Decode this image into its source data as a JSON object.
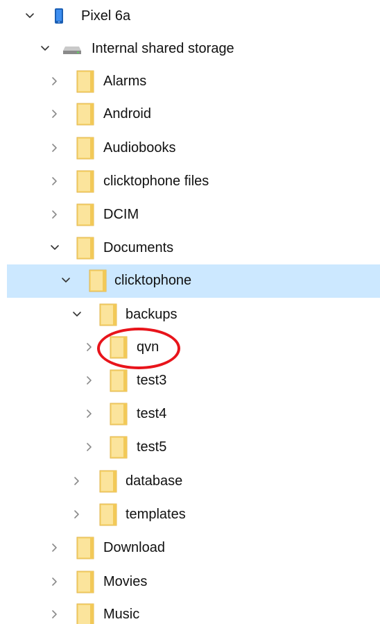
{
  "tree": [
    {
      "id": "device",
      "name": "Pixel 6a",
      "icon": "phone-icon",
      "state": "expanded",
      "level": 0
    },
    {
      "id": "storage",
      "name": "Internal shared storage",
      "icon": "drive-icon",
      "state": "expanded",
      "level": 1
    },
    {
      "id": "alarms",
      "name": "Alarms",
      "icon": "folder-icon",
      "state": "collapsed",
      "level": 2
    },
    {
      "id": "android",
      "name": "Android",
      "icon": "folder-icon",
      "state": "collapsed",
      "level": 2
    },
    {
      "id": "audiobooks",
      "name": "Audiobooks",
      "icon": "folder-icon",
      "state": "collapsed",
      "level": 2
    },
    {
      "id": "clicktophone-files",
      "name": "clicktophone files",
      "icon": "folder-icon",
      "state": "collapsed",
      "level": 2
    },
    {
      "id": "dcim",
      "name": "DCIM",
      "icon": "folder-icon",
      "state": "collapsed",
      "level": 2
    },
    {
      "id": "documents",
      "name": "Documents",
      "icon": "folder-icon",
      "state": "expanded",
      "level": 2
    },
    {
      "id": "clicktophone",
      "name": "clicktophone",
      "icon": "folder-icon",
      "state": "expanded",
      "level": 3,
      "selected": true
    },
    {
      "id": "backups",
      "name": "backups",
      "icon": "folder-icon",
      "state": "expanded",
      "level": 4
    },
    {
      "id": "qvn",
      "name": "qvn",
      "icon": "folder-icon",
      "state": "collapsed",
      "level": 5,
      "highlighted": true
    },
    {
      "id": "test3",
      "name": "test3",
      "icon": "folder-icon",
      "state": "collapsed",
      "level": 5
    },
    {
      "id": "test4",
      "name": "test4",
      "icon": "folder-icon",
      "state": "collapsed",
      "level": 5
    },
    {
      "id": "test5",
      "name": "test5",
      "icon": "folder-icon",
      "state": "collapsed",
      "level": 5
    },
    {
      "id": "database",
      "name": "database",
      "icon": "folder-icon",
      "state": "collapsed",
      "level": 4
    },
    {
      "id": "templates",
      "name": "templates",
      "icon": "folder-icon",
      "state": "collapsed",
      "level": 4
    },
    {
      "id": "download",
      "name": "Download",
      "icon": "folder-icon",
      "state": "collapsed",
      "level": 2
    },
    {
      "id": "movies",
      "name": "Movies",
      "icon": "folder-icon",
      "state": "collapsed",
      "level": 2
    },
    {
      "id": "music",
      "name": "Music",
      "icon": "folder-icon",
      "state": "collapsed",
      "level": 2
    }
  ],
  "colors": {
    "selection": "#cce8ff",
    "annotation": "#e8141b",
    "folder": "#f8d775"
  }
}
